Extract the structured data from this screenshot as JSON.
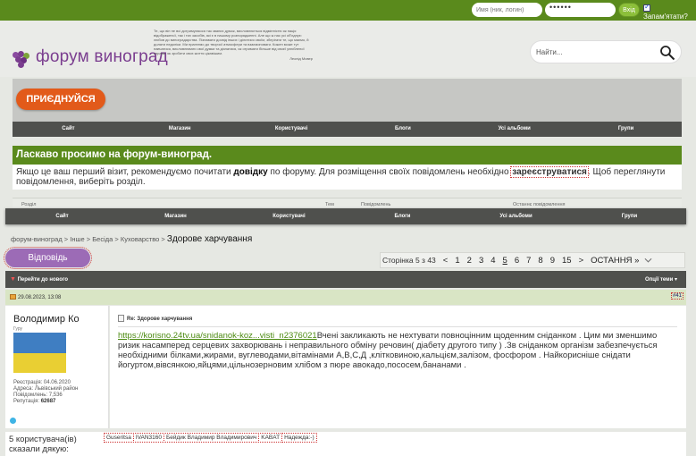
{
  "login": {
    "username_placeholder": "Имя (ник, логин)",
    "password_value": "••••••",
    "submit_label": "Вхід",
    "remember_label": "Запам'ятати?"
  },
  "header": {
    "site_title": "форум виноград",
    "quote_text": "Те, що він не всі дотримуємося так званих думок, висловлюється відмінністю як нація відображеної, так і тих засобів, які є в нашому розпорядженні. Але що ж нас усі об'єднує: любов до виноградарства. Пізнавати досвід інших і ділитися своїм, зберігати те, що маємо, й долати недоліки. Ми прагнемо до творчої атмосфери та взаємоповаги. Кожен може тут навчатися, висловлювати свої думки та дізнатися, як отримати більше від своєї улюбленої справи, як зробити своє життя цікавішим.",
    "quote_author": "Леонід Мовер",
    "search_placeholder": "Найти..."
  },
  "join_button": "ПРИЄДНУЙСЯ",
  "nav": [
    "Сайт",
    "Магазин",
    "Користувачі",
    "Блоги",
    "Усі альбоми",
    "Групи"
  ],
  "welcome": {
    "title": "Ласкаво просимо на форум-виноград.",
    "text_before": "Якщо це ваш перший візит, рекомендуємо почитати ",
    "help_link": "довідку",
    "text_middle": " по форуму. Для розміщення своїх повідомлень необхідно ",
    "register_link": "зареєструватися",
    "text_after": ". Щоб переглянути повідомлення, виберіть розділ."
  },
  "column_headers": [
    "Розділ",
    "Тем",
    "Повідомлень",
    "Останнє повідомлення"
  ],
  "breadcrumb": {
    "items": [
      "форум-виноград",
      "Інше",
      "Бесіда",
      "Куховарство"
    ],
    "current": "Здорове харчування"
  },
  "reply_button": "Відповідь",
  "pager": {
    "label": "Сторінка 5 з 43",
    "prev": "<",
    "pages": [
      "1",
      "2",
      "3",
      "4",
      "5",
      "6",
      "7",
      "8",
      "9",
      "15"
    ],
    "current": "5",
    "next": ">",
    "last": "ОСТАННЯ »"
  },
  "thread_bar": {
    "goto_new": "Перейти до нового",
    "options": "Опції теми"
  },
  "post": {
    "date": "29.08.2023, 13:08",
    "number": "#41",
    "author": "Володимир Ко",
    "rank": "Гуру",
    "reg_label": "Реєстрація:",
    "reg_value": "04.06.2020",
    "addr_label": "Адреса:",
    "addr_value": "Львівський район",
    "msgs_label": "Повідомлень:",
    "msgs_value": "7,536",
    "rep_label": "Репутація:",
    "rep_value": "62687",
    "subject": "Re: Здорове харчування",
    "link": "https://korisno.24tv.ua/snidanok-koz...visti_n2376021",
    "body": "Вчені закликають не нехтувати повноцінним щоденним сніданком . Цим ми зменшимо ризик насамперед серцевих захворювань і неправильного обміну речовин( діабету другого типу ) .Зв сніданком організм забезпечується необхідними білками,жирами, вуглеводами,вітамінами А,В,С,Д ,клітковиною,кальцієм,залізом, фосфором . Найкорисніше снідати йогуртом,вівсянкою,яйцями,цільнозерновим хлібом з пюре авокадо,пососем,бананами ."
  },
  "thanks": {
    "label": "5 користувача(ів) сказали дякую:",
    "names": [
      "Guseritsa",
      "IVAN3160",
      "Бейдик Владимир Владимирович",
      "KABAT",
      "Надежда:-)"
    ]
  },
  "colors": {
    "green": "#5a8a1c",
    "purple": "#7a3d8f",
    "orange": "#e25a1a",
    "nav_dark": "#4f504d"
  }
}
